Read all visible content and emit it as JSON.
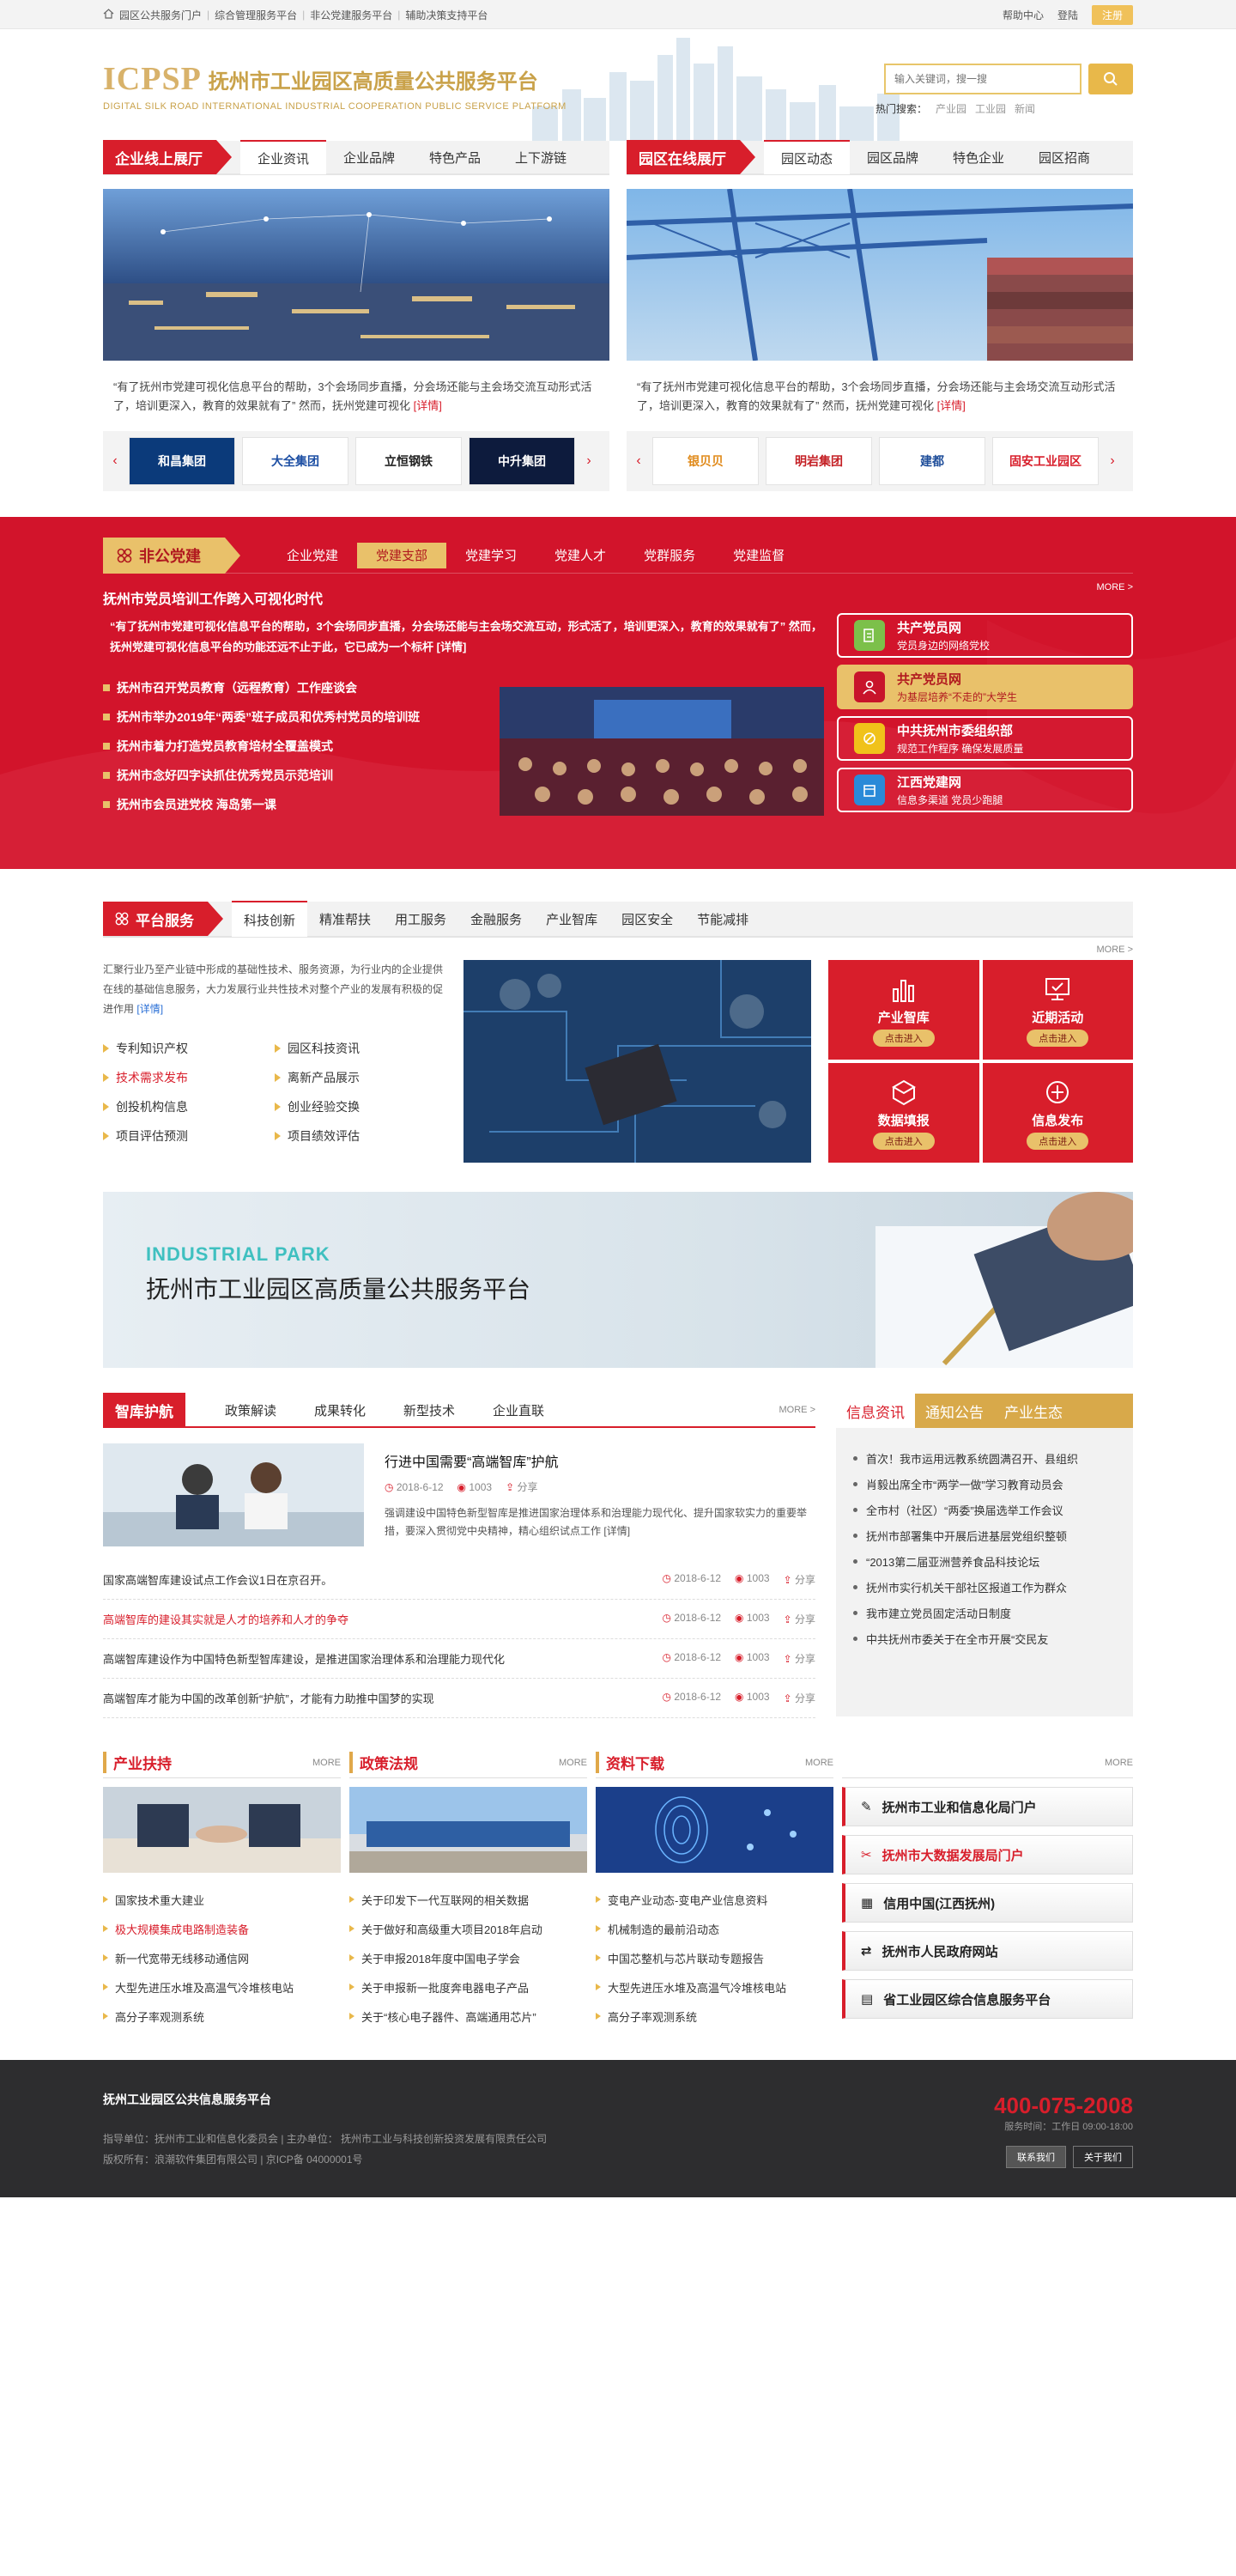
{
  "topbar": {
    "links": [
      "园区公共服务门户",
      "综合管理服务平台",
      "非公党建服务平台",
      "辅助决策支持平台"
    ],
    "help": "帮助中心",
    "login": "登陆",
    "register": "注册"
  },
  "header": {
    "logo_mark": "ICPSP",
    "title": "抚州市工业园区高质量公共服务平台",
    "subtitle": "DIGITAL SILK ROAD INTERNATIONAL INDUSTRIAL COOPERATION PUBLIC SERVICE PLATFORM",
    "search_placeholder": "输入关键词，搜一搜",
    "hot_label": "热门搜索：",
    "hot_words": [
      "产业园",
      "工业园",
      "新闻"
    ]
  },
  "enterprise": {
    "tag": "企业线上展厅",
    "tabs": [
      "企业资讯",
      "企业品牌",
      "特色产品",
      "上下游链"
    ],
    "desc": "“有了抚州市党建可视化信息平台的帮助，3个会场同步直播，分会场还能与主会场交流互动形式活了，培训更深入，教育的效果就有了” 然而，抚州党建可视化",
    "more": "[详情]",
    "logos": [
      "和昌集团",
      "大全集团",
      "立恒钢铁",
      "中升集团"
    ]
  },
  "park": {
    "tag": "园区在线展厅",
    "tabs": [
      "园区动态",
      "园区品牌",
      "特色企业",
      "园区招商"
    ],
    "desc": "“有了抚州市党建可视化信息平台的帮助，3个会场同步直播，分会场还能与主会场交流互动形式活了，培训更深入，教育的效果就有了” 然而，抚州党建可视化",
    "more": "[详情]",
    "logos": [
      "银贝贝",
      "明岩集团",
      "建都",
      "固安工业园区"
    ]
  },
  "party": {
    "tag": "非公党建",
    "tabs": [
      "企业党建",
      "党建支部",
      "党建学习",
      "党建人才",
      "党群服务",
      "党建监督"
    ],
    "more": "MORE >",
    "headline": "抚州市党员培训工作跨入可视化时代",
    "text": "“有了抚州市党建可视化信息平台的帮助，3个会场同步直播，分会场还能与主会场交流互动，形式活了，培训更深入，教育的效果就有了” 然而，抚州党建可视化信息平台的功能还远不止于此，它已成为一个标杆 [详情]",
    "list": [
      "抚州市召开党员教育（远程教育）工作座谈会",
      "抚州市举办2019年“两委”班子成员和优秀村党员的培训班",
      "抚州市着力打造党员教育培材全覆盖模式",
      "抚州市念好四字诀抓住优秀党员示范培训",
      "抚州市会员进党校  海岛第一课"
    ],
    "cards": [
      {
        "t1": "共产党员网",
        "t2": "党员身边的网络党校"
      },
      {
        "t1": "共产党员网",
        "t2": "为基层培养“不走的”大学生"
      },
      {
        "t1": "中共抚州市委组织部",
        "t2": "规范工作程序  确保发展质量"
      },
      {
        "t1": "江西党建网",
        "t2": "信息多渠道  党员少跑腿"
      }
    ]
  },
  "services": {
    "tag": "平台服务",
    "tabs": [
      "科技创新",
      "精准帮扶",
      "用工服务",
      "金融服务",
      "产业智库",
      "园区安全",
      "节能减排"
    ],
    "more": "MORE >",
    "intro": "汇聚行业乃至产业链中形成的基础性技术、服务资源，为行业内的企业提供在线的基础信息服务，大力发展行业共性技术对整个产业的发展有积极的促进作用",
    "intro_more": "[详情]",
    "items": [
      "专利知识产权",
      "园区科技资讯",
      "技术需求发布",
      "离新产品展示",
      "创投机构信息",
      "创业经验交换",
      "项目评估预测",
      "项目绩效评估"
    ],
    "tiles": [
      {
        "t": "产业智库",
        "go": "点击进入"
      },
      {
        "t": "近期活动",
        "go": "点击进入"
      },
      {
        "t": "数据填报",
        "go": "点击进入"
      },
      {
        "t": "信息发布",
        "go": "点击进入"
      }
    ]
  },
  "banner": {
    "en": "INDUSTRIAL PARK",
    "cn": "抚州市工业园区高质量公共服务平台"
  },
  "think": {
    "tag": "智库护航",
    "tabs": [
      "政策解读",
      "成果转化",
      "新型技术",
      "企业直联"
    ],
    "more": "MORE >",
    "feature": {
      "title": "行进中国需要“高端智库”护航",
      "date": "2018-6-12",
      "views": "1003",
      "share": "分享",
      "text": "强调建设中国特色新型智库是推进国家治理体系和治理能力现代化、提升国家软实力的重要举措，要深入贯彻党中央精神，精心组织试点工作",
      "more": "[详情]"
    },
    "rows": [
      {
        "t": "国家高端智库建设试点工作会议1日在京召开。",
        "date": "2018-6-12",
        "views": "1003",
        "share": "分享"
      },
      {
        "t": "高端智库的建设其实就是人才的培养和人才的争夺",
        "date": "2018-6-12",
        "views": "1003",
        "share": "分享"
      },
      {
        "t": "高端智库建设作为中国特色新型智库建设，是推进国家治理体系和治理能力现代化",
        "date": "2018-6-12",
        "views": "1003",
        "share": "分享"
      },
      {
        "t": "高端智库才能为中国的改革创新“护航”，才能有力助推中国梦的实现",
        "date": "2018-6-12",
        "views": "1003",
        "share": "分享"
      }
    ]
  },
  "info": {
    "tabs": [
      "信息资讯",
      "通知公告",
      "产业生态"
    ],
    "list": [
      "首次！我市运用远教系统圆满召开、县组织",
      "肖毅出席全市“两学一做”学习教育动员会",
      "全市村（社区）“两委”换届选举工作会议",
      "抚州市部署集中开展后进基层党组织整顿",
      "“2013第二届亚洲营养食品科技论坛",
      "抚州市实行机关干部社区报道工作为群众",
      "我市建立党员固定活动日制度",
      "中共抚州市委关于在全市开展“交民友"
    ]
  },
  "bottom": {
    "cols": [
      {
        "h": "产业扶持",
        "more": "MORE",
        "items": [
          "国家技术重大建业",
          "极大规模集成电路制造装备",
          "新一代宽带无线移动通信网",
          "大型先进压水堆及高温气冷堆核电站",
          "高分子率观测系统"
        ]
      },
      {
        "h": "政策法规",
        "more": "MORE",
        "items": [
          "关于印发下一代互联网的相关数据",
          "关于做好和高级重大项目2018年启动",
          "关于申报2018年度中国电子学会",
          "关于申报新一批度奔电器电子产品",
          "关于“核心电子器件、高端通用芯片”"
        ]
      },
      {
        "h": "资料下载",
        "more": "MORE",
        "items": [
          "变电产业动态-变电产业信息资料",
          "机械制造的最前沿动态",
          "中国芯整机与芯片联动专题报告",
          "大型先进压水堆及高温气冷堆核电站",
          "高分子率观测系统"
        ]
      }
    ],
    "portal_more": "MORE",
    "portals": [
      "抚州市工业和信息化局门户",
      "抚州市大数据发展局门户",
      "信用中国(江西抚州)",
      "抚州市人民政府网站",
      "省工业园区综合信息服务平台"
    ]
  },
  "footer": {
    "name": "抚州工业园区公共信息服务平台",
    "line1": "指导单位：抚州市工业和信息化委员会  |  主办单位：  抚州市工业与科技创新投资发展有限责任公司",
    "line2": "版权所有：浪潮软件集团有限公司  |  京ICP备 04000001号",
    "tel": "400-075-2008",
    "hours": "服务时间：工作日  09:00-18:00",
    "btn1": "联系我们",
    "btn2": "关于我们"
  }
}
